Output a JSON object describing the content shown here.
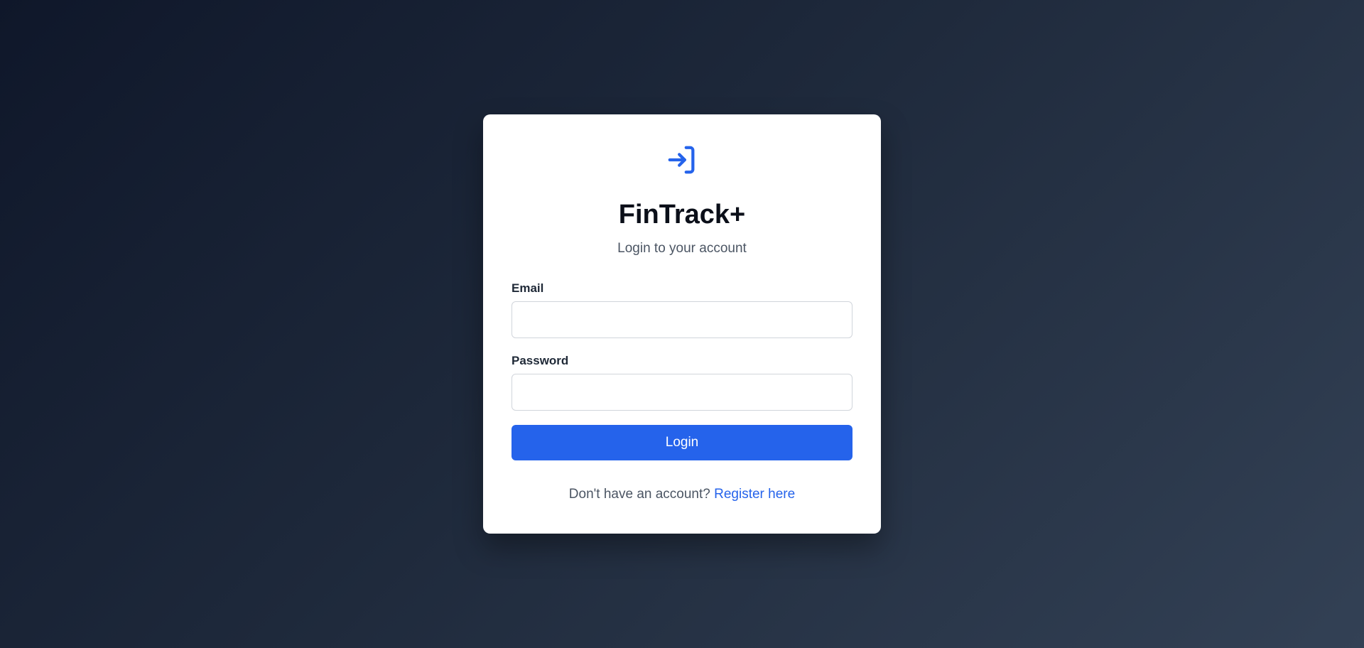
{
  "brand": {
    "title": "FinTrack+",
    "subtitle": "Login to your account",
    "icon": "login-icon",
    "accent_color": "#2563eb"
  },
  "form": {
    "email_label": "Email",
    "email_value": "",
    "password_label": "Password",
    "password_value": "",
    "login_label": "Login"
  },
  "footer": {
    "prompt": "Don't have an account?",
    "register_label": "Register here"
  }
}
